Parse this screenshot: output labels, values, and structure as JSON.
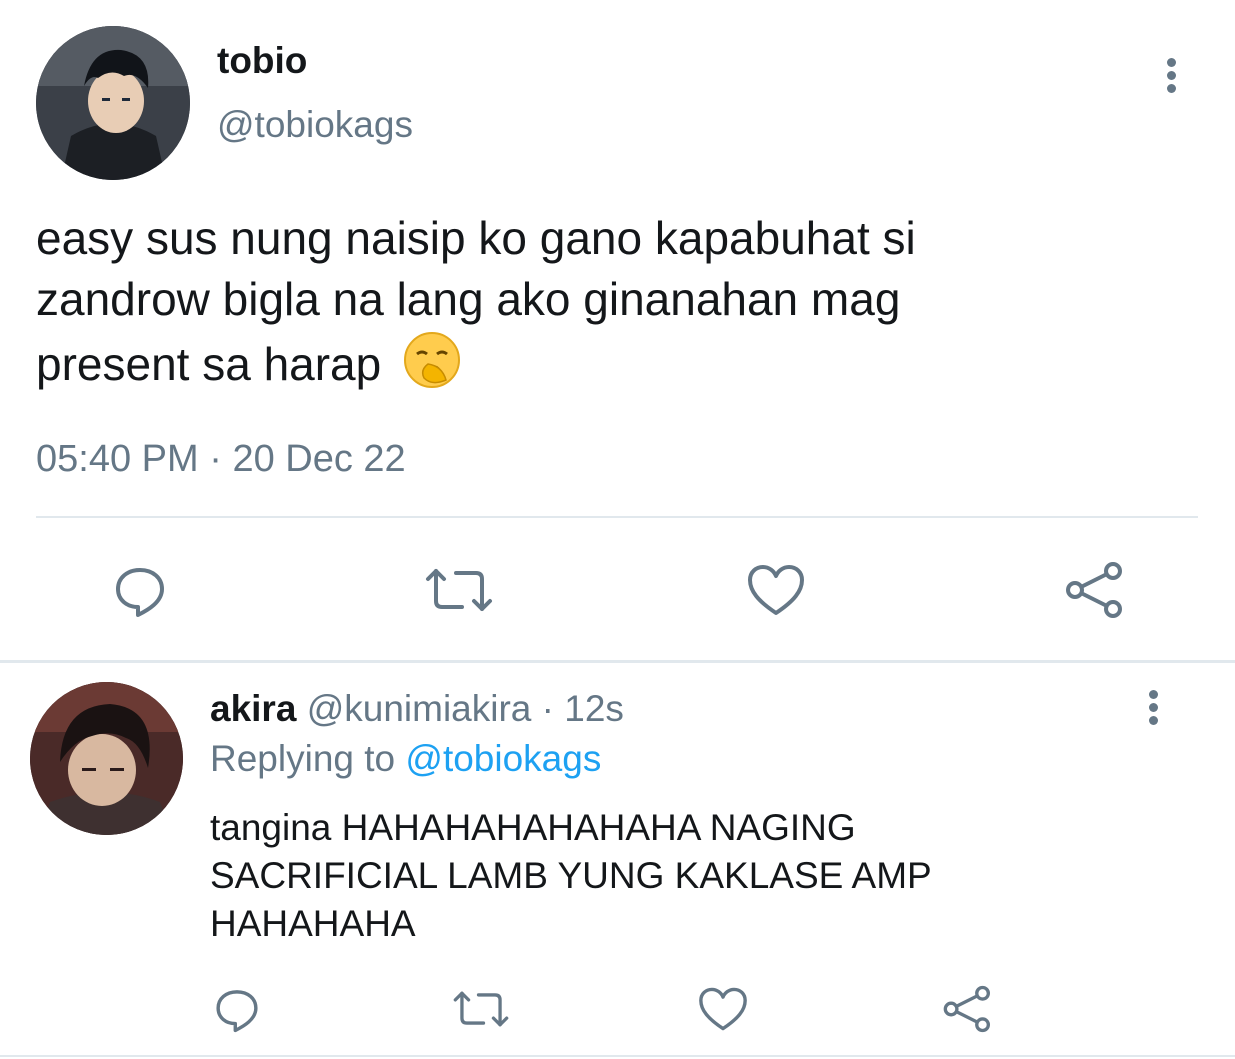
{
  "main_tweet": {
    "display_name": "tobio",
    "handle": "@tobiokags",
    "text_lines": [
      "easy sus nung naisip ko gano kapabuhat si",
      "zandrow bigla na lang ako ginanahan mag",
      "present sa harap"
    ],
    "emoji": "🥱",
    "timestamp": "05:40 PM",
    "separator": "·",
    "date": "20 Dec 22",
    "actions": [
      "reply-icon",
      "retweet-icon",
      "like-icon",
      "share-icon"
    ],
    "more_icon": "more-vertical-icon"
  },
  "reply_tweet": {
    "display_name": "akira",
    "handle": "@kunimiakira",
    "separator": "·",
    "time_ago": "12s",
    "replying_to_label": "Replying to",
    "replying_to_handle": "@tobiokags",
    "text_lines": [
      "tangina HAHAHAHAHAHAHA NAGING",
      "SACRIFICIAL LAMB YUNG KAKLASE AMP",
      "HAHAHAHA"
    ],
    "actions": [
      "reply-icon",
      "retweet-icon",
      "like-icon",
      "share-icon"
    ],
    "more_icon": "more-vertical-icon"
  },
  "colors": {
    "text": "#14171a",
    "secondary": "#657786",
    "link": "#1da1f2",
    "divider": "#e1e8ed",
    "background": "#ffffff"
  }
}
